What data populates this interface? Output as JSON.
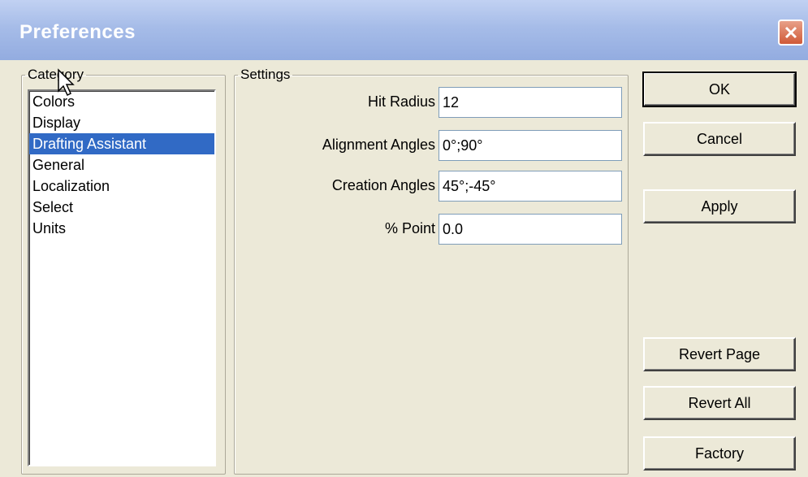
{
  "window": {
    "title": "Preferences"
  },
  "category": {
    "legend": "Category",
    "items": [
      {
        "label": "Colors"
      },
      {
        "label": "Display"
      },
      {
        "label": "Drafting Assistant"
      },
      {
        "label": "General"
      },
      {
        "label": "Localization"
      },
      {
        "label": "Select"
      },
      {
        "label": "Units"
      }
    ],
    "selected": "Drafting Assistant"
  },
  "settings": {
    "legend": "Settings",
    "fields": [
      {
        "label": "Hit Radius",
        "value": "12"
      },
      {
        "label": "Alignment Angles",
        "value": "0°;90°"
      },
      {
        "label": "Creation Angles",
        "value": "45°;-45°"
      },
      {
        "label": "% Point",
        "value": "0.0"
      }
    ]
  },
  "buttons": {
    "ok": "OK",
    "cancel": "Cancel",
    "apply": "Apply",
    "revert_page": "Revert Page",
    "revert_all": "Revert All",
    "factory": "Factory"
  },
  "icons": {
    "close": "close-icon",
    "cursor": "mouse-pointer-icon"
  },
  "colors": {
    "selection": "#316AC5",
    "titlebar": "#A6BCE8",
    "close": "#D05A38"
  }
}
